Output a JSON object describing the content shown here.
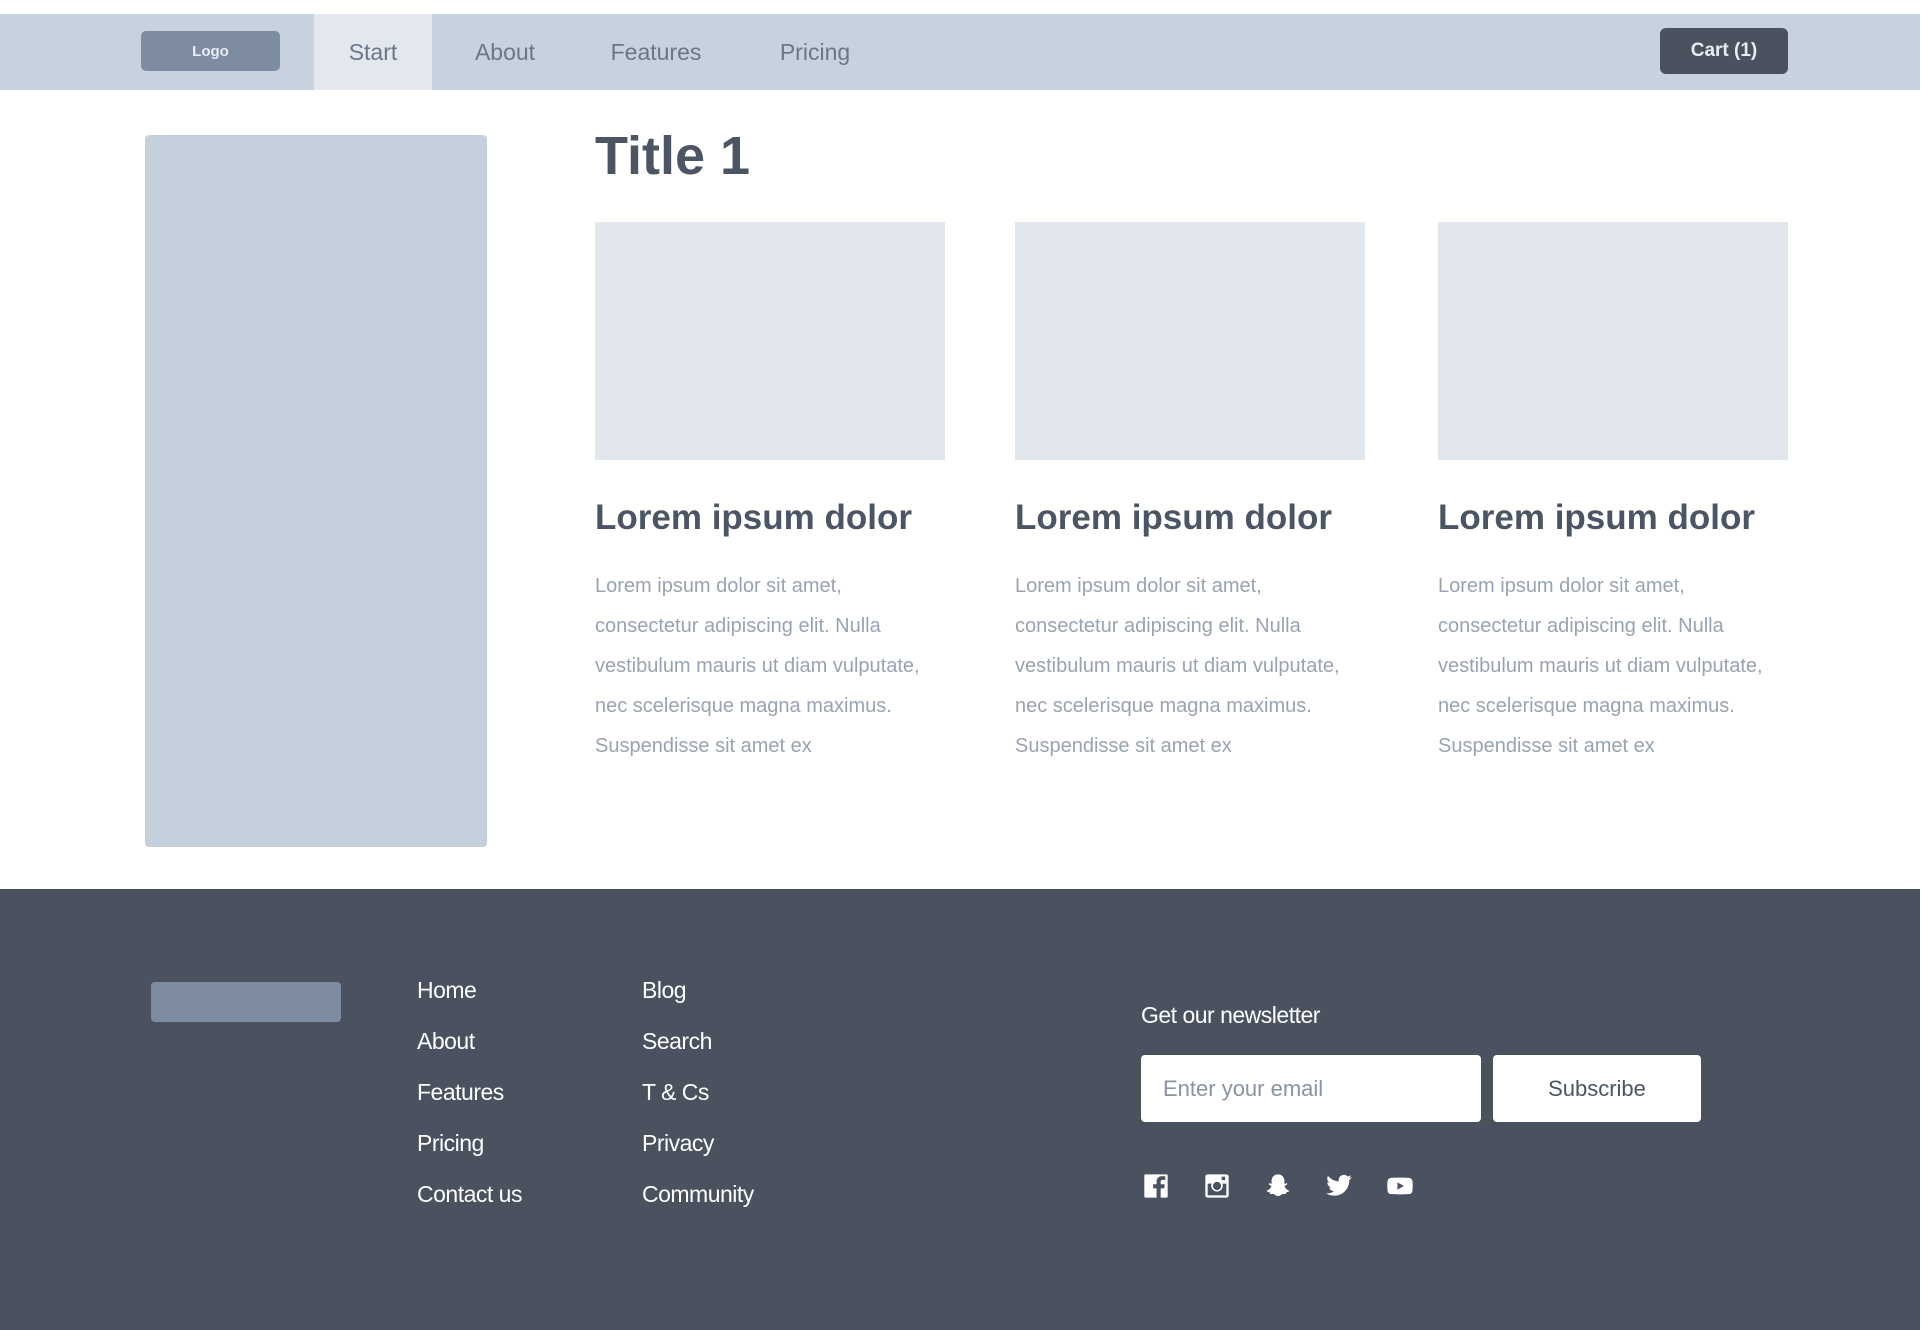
{
  "nav": {
    "logo_label": "Logo",
    "items": [
      {
        "label": "Start",
        "active": true
      },
      {
        "label": "About",
        "active": false
      },
      {
        "label": "Features",
        "active": false
      },
      {
        "label": "Pricing",
        "active": false
      }
    ],
    "cart_label": "Cart (1)"
  },
  "main": {
    "title": "Title 1",
    "cards": [
      {
        "title": "Lorem ipsum dolor",
        "body": "Lorem ipsum dolor sit amet, consectetur adipiscing elit. Nulla vestibulum mauris ut diam vulputate, nec scelerisque magna maximus. Suspendisse sit amet ex"
      },
      {
        "title": "Lorem ipsum dolor",
        "body": "Lorem ipsum dolor sit amet, consectetur adipiscing elit. Nulla vestibulum mauris ut diam vulputate, nec scelerisque magna maximus. Suspendisse sit amet ex"
      },
      {
        "title": "Lorem ipsum dolor",
        "body": "Lorem ipsum dolor sit amet, consectetur adipiscing elit. Nulla vestibulum mauris ut diam vulputate, nec scelerisque magna maximus. Suspendisse sit amet ex"
      }
    ]
  },
  "footer": {
    "col1": [
      "Home",
      "About",
      "Features",
      "Pricing",
      "Contact us"
    ],
    "col2": [
      "Blog",
      "Search",
      "T & Cs",
      "Privacy",
      "Community"
    ],
    "newsletter_label": "Get our newsletter",
    "email_placeholder": "Enter your email",
    "subscribe_label": "Subscribe",
    "socials": [
      "facebook-icon",
      "instagram-icon",
      "snapchat-icon",
      "twitter-icon",
      "youtube-icon"
    ]
  },
  "colors": {
    "nav_bg": "#c8d2de",
    "footer_bg": "#4a5260",
    "placeholder_gray": "#c5d0dd",
    "card_image_gray": "#e2e7ee",
    "heading": "#4b5563"
  }
}
